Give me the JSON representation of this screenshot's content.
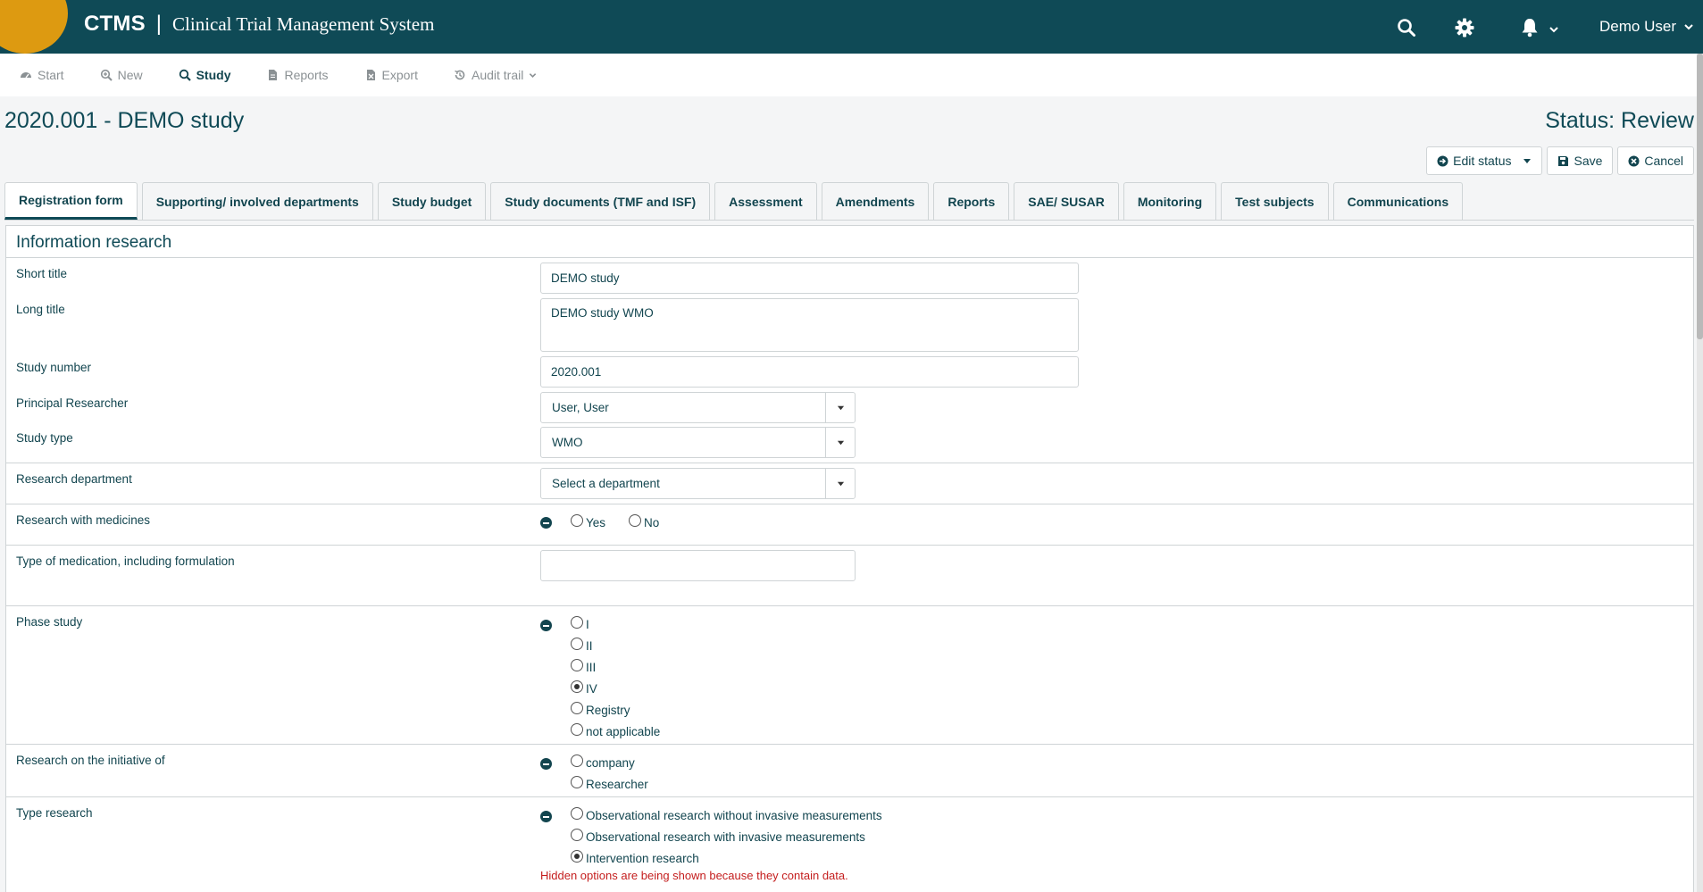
{
  "header": {
    "brand_short": "CTMS",
    "brand_sep": "|",
    "brand_full": "Clinical Trial Management System",
    "user_name": "Demo User",
    "colors": {
      "bar": "#0f4a56",
      "logo": "#dd9a11"
    },
    "icons": [
      "search-icon",
      "gear-icon",
      "bell-icon",
      "chevron-down-icon"
    ]
  },
  "nav": {
    "start": "Start",
    "new": "New",
    "study": "Study",
    "reports": "Reports",
    "export": "Export",
    "audit": "Audit trail"
  },
  "page": {
    "title": "2020.001 - DEMO study",
    "status": "Status: Review"
  },
  "actions": {
    "edit_status": "Edit status",
    "save": "Save",
    "cancel": "Cancel"
  },
  "tabs": [
    "Registration form",
    "Supporting/ involved departments",
    "Study budget",
    "Study documents (TMF and ISF)",
    "Assessment",
    "Amendments",
    "Reports",
    "SAE/ SUSAR",
    "Monitoring",
    "Test subjects",
    "Communications"
  ],
  "form": {
    "section_title": "Information research",
    "short_title": {
      "label": "Short title",
      "value": "DEMO study"
    },
    "long_title": {
      "label": "Long title",
      "value": "DEMO study WMO"
    },
    "study_number": {
      "label": "Study number",
      "value": "2020.001"
    },
    "principal": {
      "label": "Principal Researcher",
      "value": "User, User"
    },
    "study_type": {
      "label": "Study type",
      "value": "WMO"
    },
    "department": {
      "label": "Research department",
      "value": "Select a department"
    },
    "medicines": {
      "label": "Research with medicines",
      "options": [
        "Yes",
        "No"
      ],
      "selected": null
    },
    "medication_type": {
      "label": "Type of medication, including formulation",
      "value": ""
    },
    "phase": {
      "label": "Phase study",
      "options": [
        "I",
        "II",
        "III",
        "IV",
        "Registry",
        "not applicable"
      ],
      "selected": "IV"
    },
    "initiative": {
      "label": "Research on the initiative of",
      "options": [
        "company",
        "Researcher"
      ],
      "selected": null
    },
    "type_research": {
      "label": "Type research",
      "options": [
        "Observational research without invasive measurements",
        "Observational research with invasive measurements",
        "Intervention research"
      ],
      "selected": "Intervention research",
      "warning": "Hidden options are being shown because they contain data."
    }
  }
}
